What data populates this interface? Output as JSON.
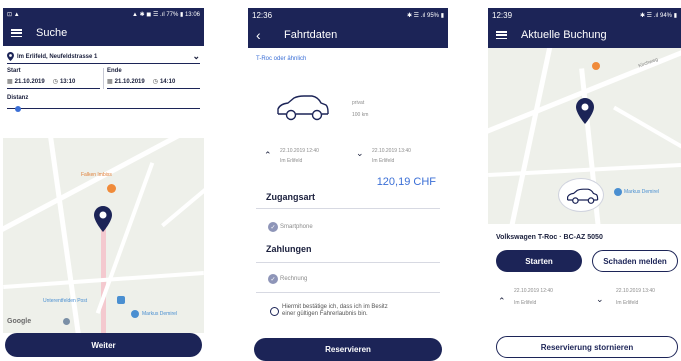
{
  "screen1": {
    "status_left": "⊡ ▲",
    "status_right": "▲ ✱ ◼ ☰ .ıl 77% ▮ 13:06",
    "title": "Suche",
    "location": "Im Erlifeld, Neufeldstrasse 1",
    "start_label": "Start",
    "end_label": "Ende",
    "start_date": "21.10.2019",
    "start_time": "13:10",
    "end_date": "21.10.2019",
    "end_time": "14:10",
    "distance_label": "Distanz",
    "map_labels": {
      "falken": "Falken Imbiss",
      "post": "Unterentfelden Post",
      "markus": "Markus Demirel",
      "google": "Google"
    },
    "continue_label": "Weiter",
    "accent": "#1c2457",
    "poi_orange": "#f08b3a"
  },
  "screen2": {
    "status_time": "12:36",
    "status_right": "✱ ☰ .ıl 95% ▮",
    "title": "Fahrtdaten",
    "car_model": "T-Roc oder ähnlich",
    "car_type": "privat",
    "car_distance": "100 km",
    "start_datetime": "22.10.2019 12:40",
    "start_place": "Im Erlifeld",
    "end_datetime": "22.10.2019 13:40",
    "end_place": "Im Erlifeld",
    "price": "120,19 CHF",
    "access_heading": "Zugangsart",
    "access_option": "Smartphone",
    "payment_heading": "Zahlungen",
    "payment_option": "Rechnung",
    "license_text_1": "Hiermit bestätige ich, dass ich im Besitz",
    "license_text_2": "einer gültigen Fahrerlaubnis bin.",
    "reserve_label": "Reservieren",
    "link_color": "#3b6fd6"
  },
  "screen3": {
    "status_time": "12:39",
    "status_right": "✱ ☰ .ıl 94% ▮",
    "title": "Aktuelle Buchung",
    "map_labels": {
      "kirchweg": "Kirchweg",
      "markus": "Markus Demirel"
    },
    "vehicle": "Volkswagen T-Roc · BC-AZ 5050",
    "start_label": "Starten",
    "damage_label": "Schaden melden",
    "start_datetime": "22.10.2019 12:40",
    "start_place": "Im Erlifeld",
    "end_datetime": "22.10.2019 13:40",
    "end_place": "Im Erlifeld",
    "cancel_label": "Reservierung stornieren"
  }
}
